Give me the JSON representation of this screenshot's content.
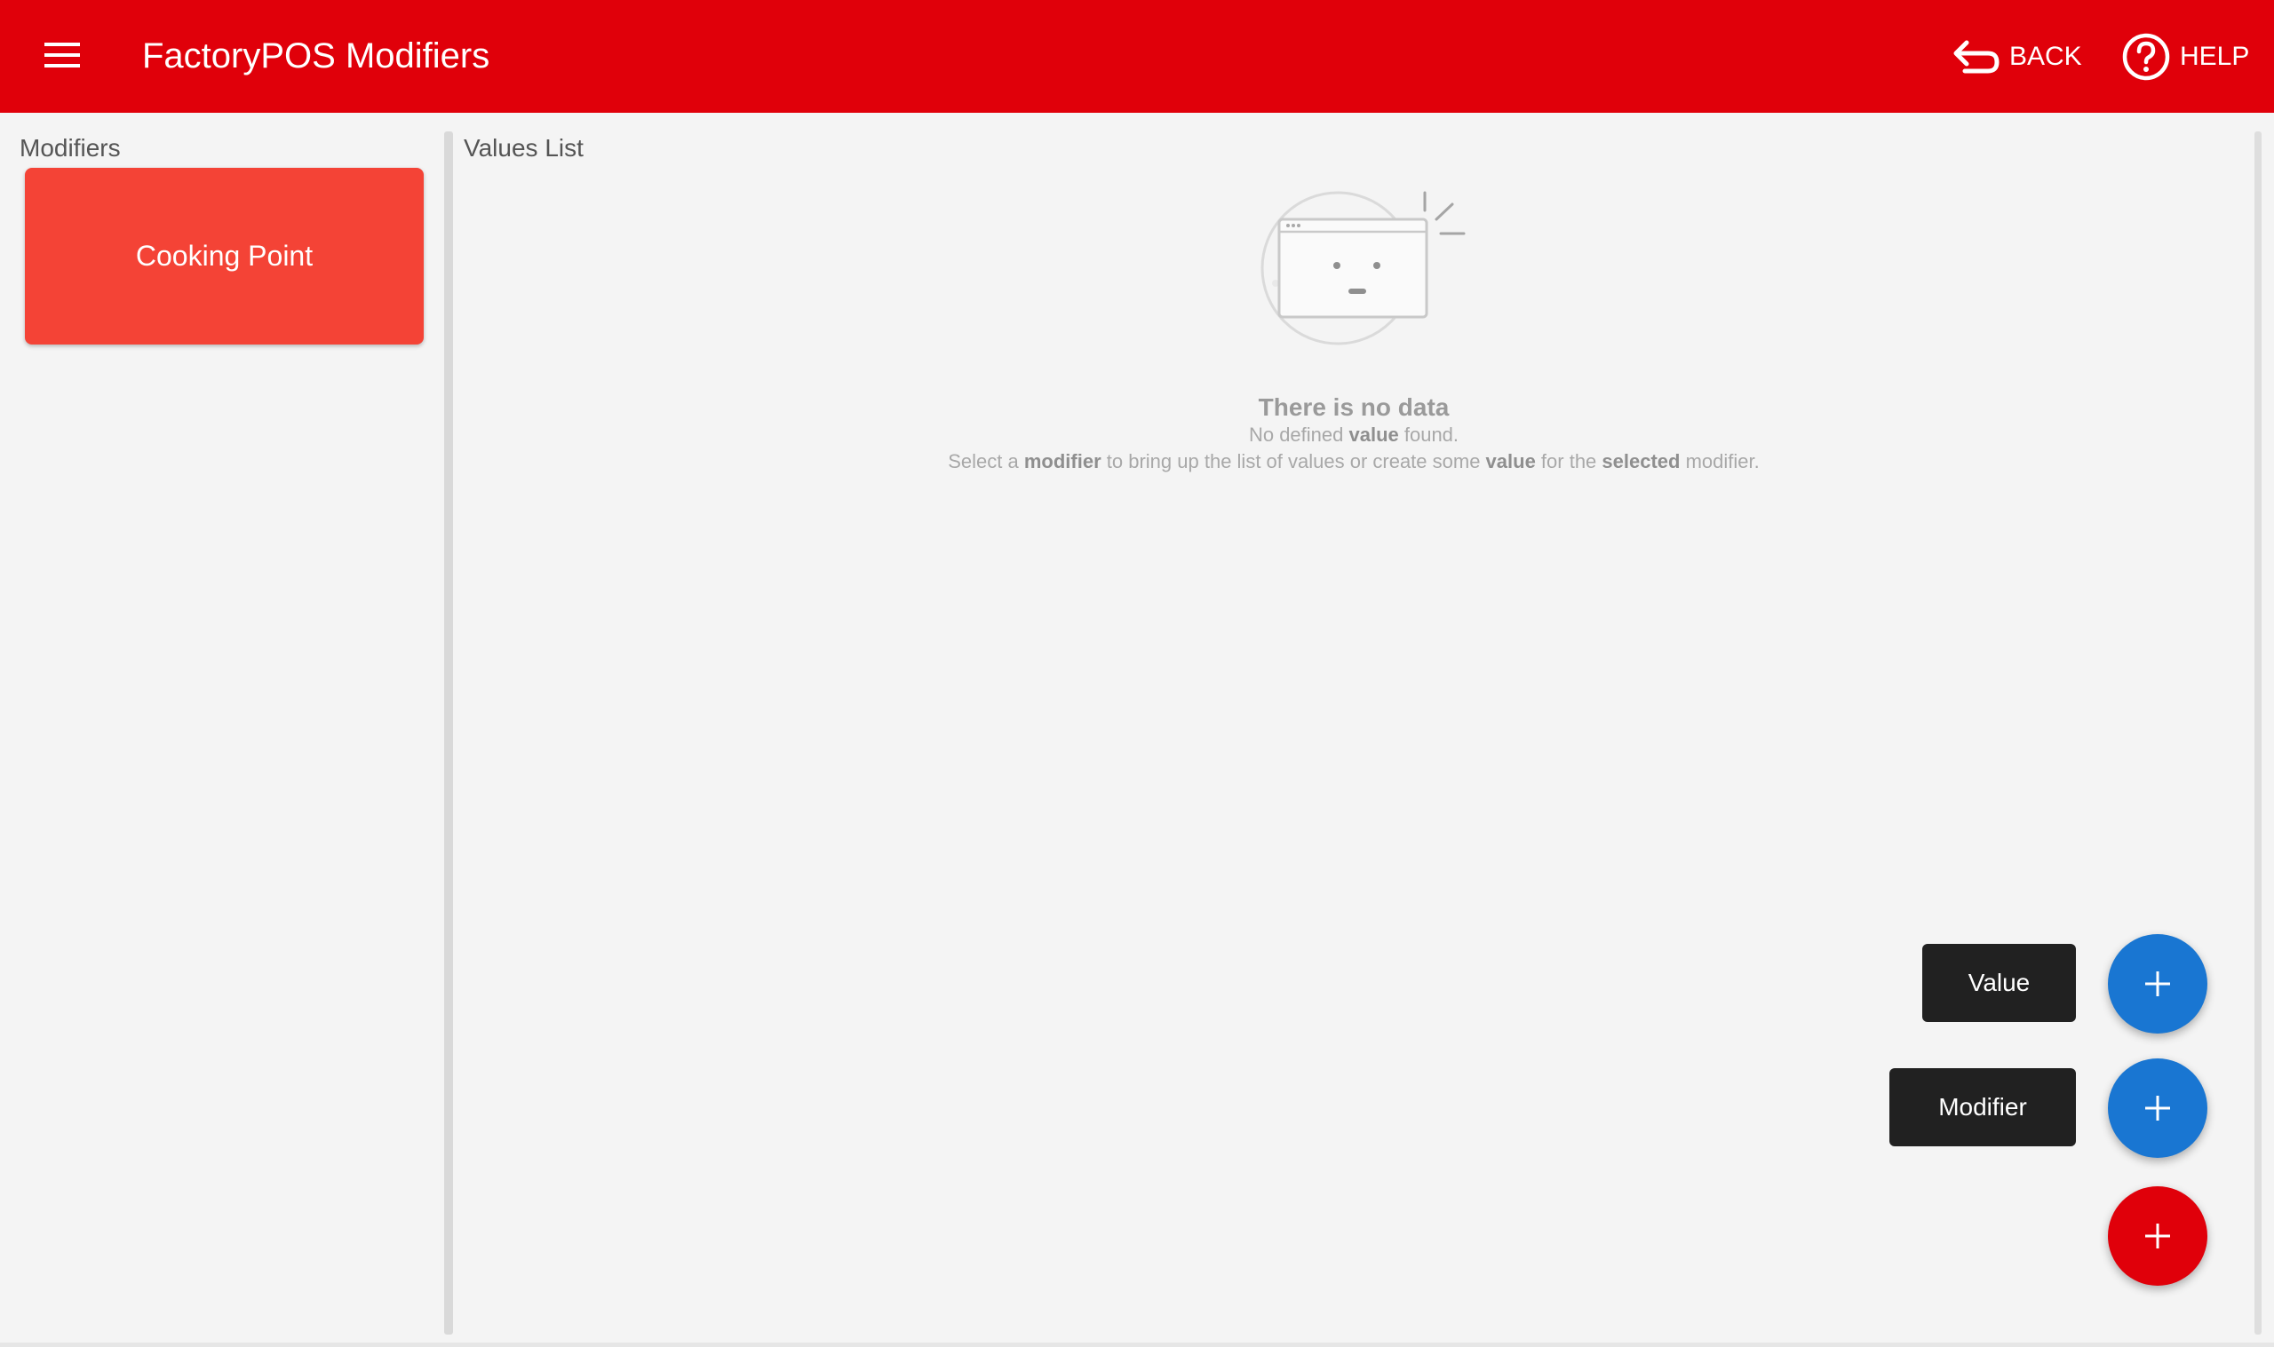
{
  "header": {
    "title": "FactoryPOS Modifiers",
    "back_label": "BACK",
    "help_label": "HELP"
  },
  "modifiers_panel": {
    "label": "Modifiers",
    "items": [
      {
        "label": "Cooking Point"
      }
    ]
  },
  "values_panel": {
    "label": "Values List",
    "empty": {
      "title": "There is no data",
      "line1": [
        "No defined ",
        "value",
        " found."
      ],
      "line2": [
        "Select a ",
        "modifier",
        " to bring up the list of values or create some ",
        "value",
        " for the ",
        "selected",
        " modifier."
      ]
    }
  },
  "fab_menu": {
    "value_label": "Value",
    "modifier_label": "Modifier"
  },
  "colors": {
    "primary": "#e0000a",
    "card": "#f44336",
    "fab_secondary": "#1976d2",
    "label_bg": "#212121"
  },
  "icons": {
    "menu": "menu-icon",
    "back": "back-arrow-icon",
    "help": "help-circle-icon",
    "add": "plus-icon"
  }
}
